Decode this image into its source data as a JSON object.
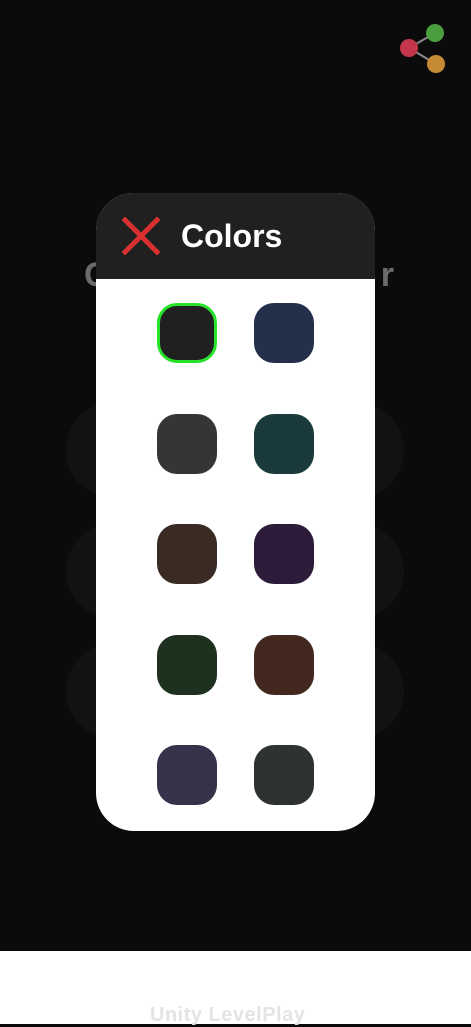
{
  "background": {
    "title_left": "C",
    "title_right": "r"
  },
  "modal": {
    "title": "Colors",
    "close_icon": "close-icon",
    "selected_index": 0,
    "colors": [
      "#202020",
      "#24304a",
      "#353535",
      "#1a3a3c",
      "#3a2a24",
      "#2c1c3a",
      "#1d311e",
      "#432820",
      "#36324a",
      "#2e3232"
    ]
  },
  "share": {
    "icon": "share-icon"
  },
  "ad": {
    "text": "Unity LevelPlay"
  },
  "colors": {
    "close_red": "#d93030",
    "selected_border": "#27e22a"
  }
}
